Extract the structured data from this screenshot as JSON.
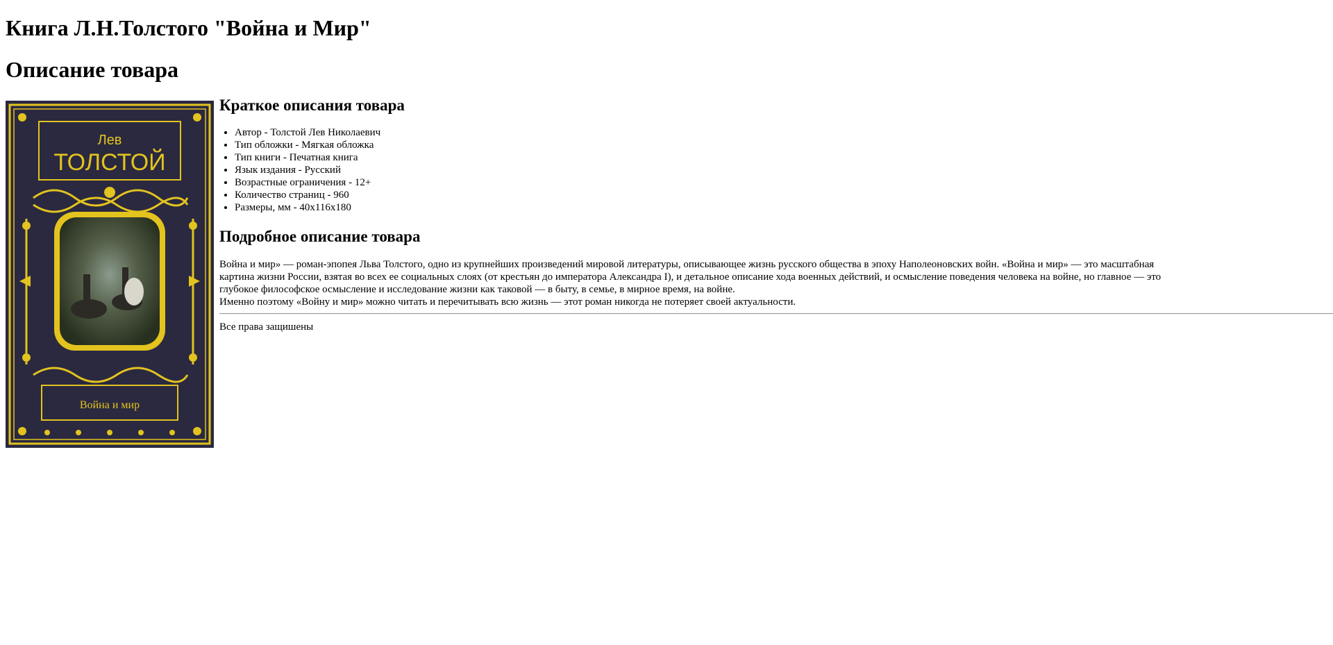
{
  "page": {
    "title": "Книга Л.Н.Толстого \"Война и Мир\"",
    "section_title": "Описание товара"
  },
  "cover": {
    "author_first": "Лев",
    "author_last": "ТОЛСТОЙ",
    "book_title": "Война и мир",
    "colors": {
      "background": "#2a2940",
      "gold": "#e3c31e"
    }
  },
  "short_description": {
    "heading": "Краткое описания товара",
    "items": [
      "Автор - Толстой Лев Николаевич",
      "Тип обложки - Мягкая обложка",
      "Тип книги - Печатная книга",
      "Язык издания - Русский",
      "Возрастные ограничения - 12+",
      "Количество страниц - 960",
      "Размеры, мм - 40x116x180"
    ]
  },
  "detailed_description": {
    "heading": "Подробное описание товара",
    "paragraph_1": "Война и мир» — роман-эпопея Льва Толстого, одно из крупнейших произведений мировой литературы, описывающее жизнь русского общества в эпоху Наполеоновских войн. «Война и мир» — это масштабная картина жизни России, взятая во всех ее социальных слоях (от крестьян до императора Александра I), и детальное описание хода военных действий, и осмысление поведения человека на войне, но главное — это глубокое философское осмысление и исследование жизни как таковой — в быту, в семье, в мирное время, на войне.",
    "paragraph_2": "Именно поэтому «Войну и мир» можно читать и перечитывать всю жизнь — этот роман никогда не потеряет своей актуальности."
  },
  "footer": {
    "copyright": "Все права защишены"
  }
}
